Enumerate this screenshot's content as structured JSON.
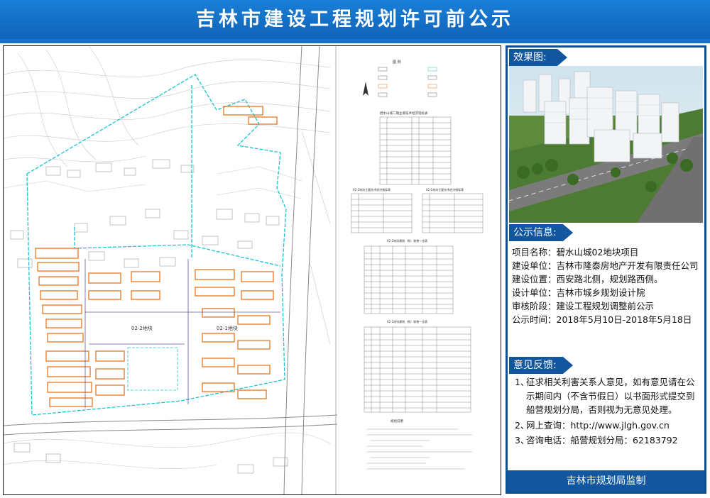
{
  "header": {
    "title": "吉林市建设工程规划许可前公示"
  },
  "plan": {
    "block_labels": [
      "02-2地块",
      "02-1地块"
    ],
    "legend_title": "图  例",
    "table1_title": "碧水山城二期主要技术经济指标表",
    "table2_title": "02-2地块主要技术经济指标表",
    "table3_title": "02-1地块主要技术经济指标表",
    "table4_title": "02-2地块建筑（构）筑物一览表",
    "table5_title": "02-1地块建筑（构）筑物一览表",
    "notes_title": "规划说明"
  },
  "sidebar": {
    "effect_label": "效果图:",
    "info_label": "公示信息:",
    "info": [
      {
        "label": "项目名称：",
        "value": "碧水山城02地块项目"
      },
      {
        "label": "建设单位：",
        "value": "吉林市隆泰房地产开发有限责任公司"
      },
      {
        "label": "建设位置：",
        "value": "西安路北侧，规划路西侧。"
      },
      {
        "label": "设计单位：",
        "value": "吉林市城乡规划设计院"
      },
      {
        "label": "审核阶段：",
        "value": "建设工程规划调整前公示"
      },
      {
        "label": "公示时间：",
        "value": "2018年5月10日-2018年5月18日"
      }
    ],
    "feedback_label": "意见反馈:",
    "feedback": [
      {
        "num": "1、",
        "text": "征求相关利害关系人意见，如有意见请在公示期间内（不含节假日）以书面形式提交到船营规划分局，否则视为无意见处理。"
      },
      {
        "num": "2、",
        "text": "网上查询：http://www.jlgh.gov.cn"
      },
      {
        "num": "3、",
        "text": "咨询电话：船营规划分局：62183792"
      }
    ],
    "footer": "吉林市规划局监制"
  }
}
